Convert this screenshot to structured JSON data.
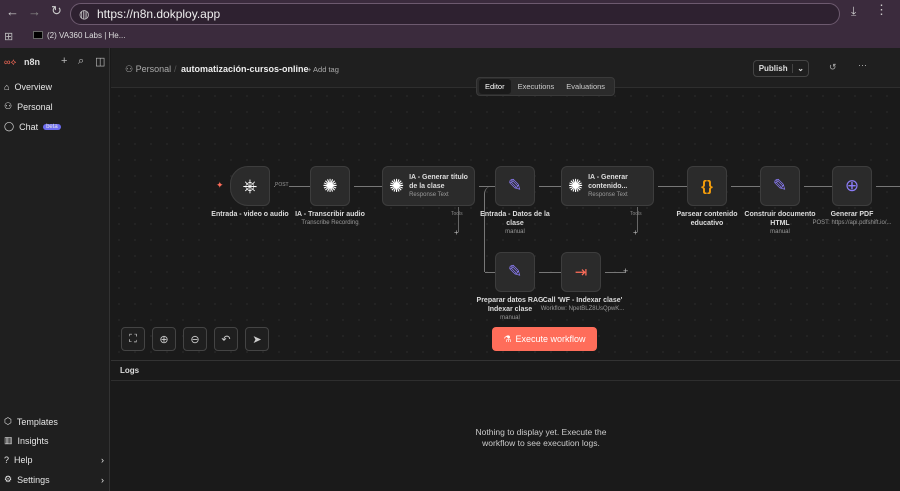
{
  "browser": {
    "url": "https://n8n.dokploy.app",
    "bookmark": "(2) VA360 Labs | He..."
  },
  "sidebar": {
    "brand": "n8n",
    "items": [
      {
        "label": "Overview"
      },
      {
        "label": "Personal"
      },
      {
        "label": "Chat",
        "badge": "beta"
      }
    ],
    "bottom": [
      {
        "label": "Templates"
      },
      {
        "label": "Insights"
      },
      {
        "label": "Help"
      },
      {
        "label": "Settings"
      }
    ]
  },
  "header": {
    "project": "Personal",
    "workflow": "automatización-cursos-online",
    "add_tag": "+ Add tag",
    "publish": "Publish",
    "tabs": [
      "Editor",
      "Executions",
      "Evaluations"
    ]
  },
  "nodes": [
    {
      "name": "Entrada - video o audio",
      "sub": "",
      "edge_label": "POST"
    },
    {
      "name": "IA - Transcribir audio",
      "sub": "Transcribe Recording"
    },
    {
      "name": "IA - Generar título de la clase",
      "sub": "Response Text",
      "tools": "Tools"
    },
    {
      "name": "Entrada - Datos de la clase",
      "sub": "manual"
    },
    {
      "name": "IA - Generar contenido...",
      "sub": "Response Text",
      "tools": "Tools"
    },
    {
      "name": "Parsear contenido educativo",
      "sub": ""
    },
    {
      "name": "Construir documento HTML",
      "sub": "manual"
    },
    {
      "name": "Generar PDF",
      "sub": "POST: https://api.pdfshift.io/..."
    },
    {
      "name": "Preparar datos RAG Indexar clase",
      "sub": "manual"
    },
    {
      "name": "Call 'WF - Indexar clase'",
      "sub": "Workflow: NpetBLZ8UsQpwK..."
    }
  ],
  "execute": "Execute workflow",
  "logs": {
    "title": "Logs",
    "empty": "Nothing to display yet. Execute the workflow to see execution logs."
  },
  "colors": {
    "accent": "#ff6d5a",
    "purple": "#8b7cf6",
    "orange": "#f59e0b"
  }
}
